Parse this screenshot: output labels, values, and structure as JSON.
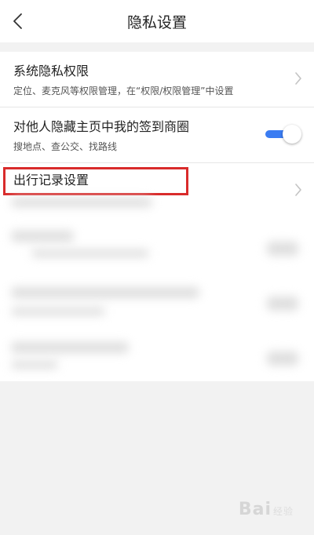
{
  "nav": {
    "title": "隐私设置"
  },
  "rows": [
    {
      "title": "系统隐私权限",
      "subtitle": "定位、麦克风等权限管理，在“权限/权限管理”中设置"
    },
    {
      "title": "对他人隐藏主页中我的签到商圈",
      "subtitle": "搜地点、查公交、找路线",
      "toggle_on": true
    },
    {
      "title": "出行记录设置"
    }
  ],
  "colors": {
    "accent": "#3a7cf2",
    "highlight": "#d92b2b"
  },
  "icons": {
    "back": "chevron-left-icon",
    "chevron": "chevron-right-icon"
  },
  "watermark": {
    "brand": "Bai",
    "suffix": "经验"
  }
}
